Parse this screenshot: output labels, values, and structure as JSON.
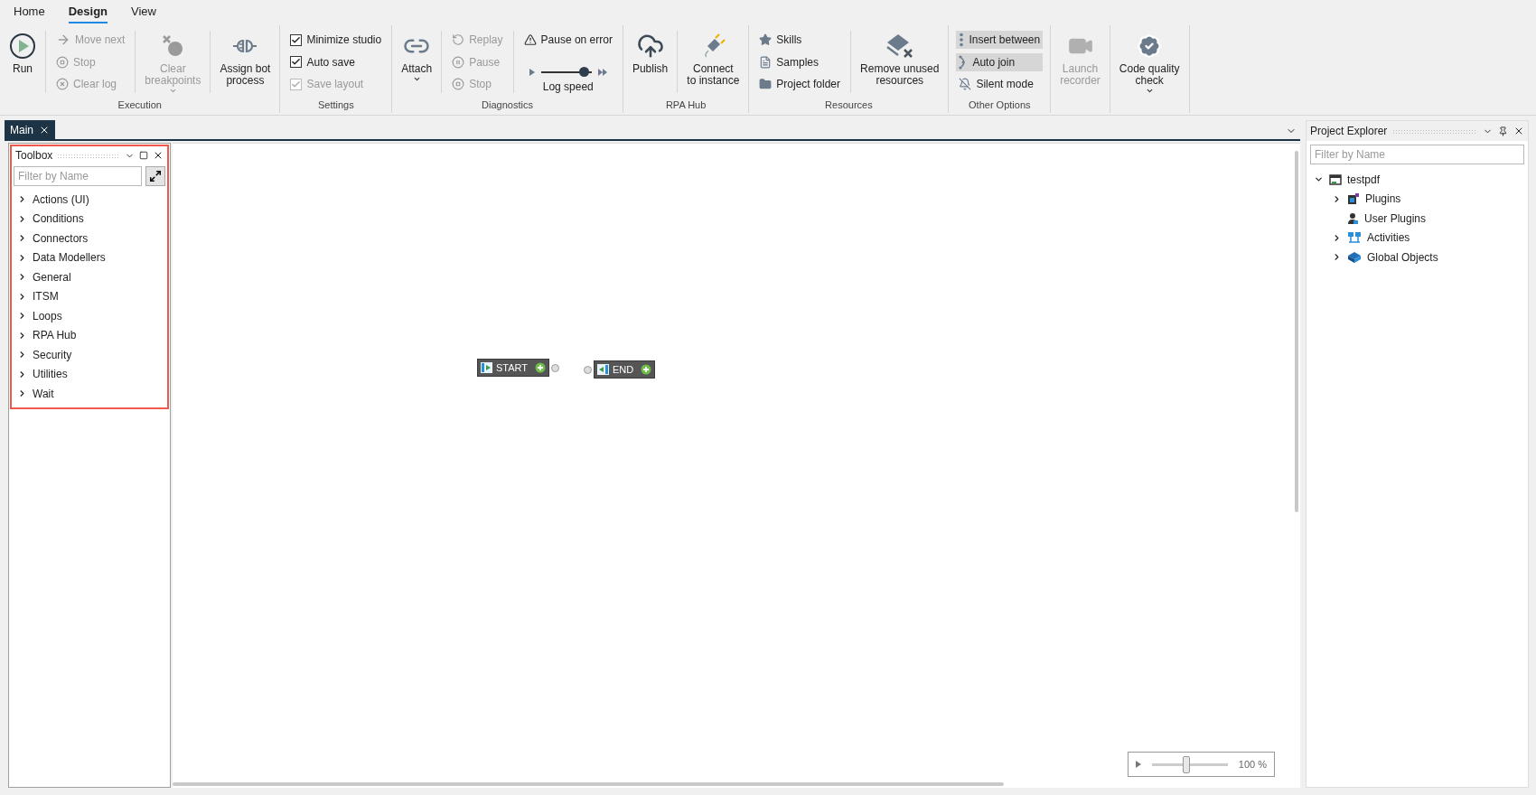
{
  "ribbon": {
    "tabs": [
      {
        "label": "Home",
        "selected": false
      },
      {
        "label": "Design",
        "selected": true
      },
      {
        "label": "View",
        "selected": false
      }
    ],
    "groups": [
      {
        "label": "Execution",
        "columns": [
          {
            "kind": "large",
            "label": "Run",
            "disabled": false
          },
          {
            "kind": "stack",
            "items": [
              {
                "kind": "button",
                "label": "Move next",
                "disabled": true
              },
              {
                "kind": "button",
                "label": "Stop",
                "disabled": true
              },
              {
                "kind": "button",
                "label": "Clear log",
                "disabled": true
              }
            ]
          },
          {
            "kind": "large",
            "label": "Clear\nbreakpoints",
            "disabled": true,
            "dropdown": true
          },
          {
            "kind": "large",
            "label": "Assign bot\nprocess",
            "disabled": false
          }
        ]
      },
      {
        "label": "Settings",
        "columns": [
          {
            "kind": "stack",
            "items": [
              {
                "kind": "check",
                "label": "Minimize studio",
                "checked": true,
                "disabled": false
              },
              {
                "kind": "check",
                "label": "Auto save",
                "checked": true,
                "disabled": false
              },
              {
                "kind": "check",
                "label": "Save layout",
                "checked": true,
                "disabled": true
              }
            ]
          }
        ]
      },
      {
        "label": "Diagnostics",
        "columns": [
          {
            "kind": "large",
            "label": "Attach",
            "disabled": false,
            "dropdown": true
          },
          {
            "kind": "stack",
            "items": [
              {
                "kind": "button",
                "label": "Replay",
                "disabled": true
              },
              {
                "kind": "button",
                "label": "Pause",
                "disabled": true
              },
              {
                "kind": "button",
                "label": "Stop",
                "disabled": true
              }
            ]
          },
          {
            "kind": "stack",
            "items": [
              {
                "kind": "button",
                "label": "Pause on error",
                "disabled": false
              },
              {
                "kind": "slider",
                "label": "Log speed",
                "level": 0.85
              }
            ]
          }
        ]
      },
      {
        "label": "RPA Hub",
        "columns": [
          {
            "kind": "large",
            "label": "Publish",
            "disabled": false
          },
          {
            "kind": "large",
            "label": "Connect\nto instance",
            "disabled": false
          }
        ]
      },
      {
        "label": "Resources",
        "columns": [
          {
            "kind": "stack",
            "items": [
              {
                "kind": "button",
                "label": "Skills",
                "disabled": false
              },
              {
                "kind": "button",
                "label": "Samples",
                "disabled": false
              },
              {
                "kind": "button",
                "label": "Project folder",
                "disabled": false
              }
            ]
          },
          {
            "kind": "large",
            "label": "Remove unused\nresources",
            "disabled": false
          }
        ]
      },
      {
        "label": "Other Options",
        "columns": [
          {
            "kind": "stack",
            "items": [
              {
                "kind": "toggle",
                "label": "Insert between",
                "on": true
              },
              {
                "kind": "toggle",
                "label": "Auto join",
                "on": true
              },
              {
                "kind": "toggle",
                "label": "Silent mode",
                "on": false
              }
            ]
          }
        ]
      },
      {
        "columns": [
          {
            "kind": "large",
            "label": "Launch\nrecorder",
            "disabled": true
          }
        ]
      },
      {
        "columns": [
          {
            "kind": "large",
            "label": "Code quality\ncheck",
            "disabled": false,
            "dropdown": true
          }
        ]
      }
    ]
  },
  "document_tabs": [
    {
      "label": "Main",
      "selected": true
    }
  ],
  "toolbox": {
    "title": "Toolbox",
    "filter": {
      "placeholder": "Filter by Name"
    },
    "items": [
      {
        "label": "Actions (UI)",
        "expanded": false
      },
      {
        "label": "Conditions",
        "expanded": false
      },
      {
        "label": "Connectors",
        "expanded": false
      },
      {
        "label": "Data Modellers",
        "expanded": false
      },
      {
        "label": "General",
        "expanded": false
      },
      {
        "label": "ITSM",
        "expanded": false
      },
      {
        "label": "Loops",
        "expanded": false
      },
      {
        "label": "RPA Hub",
        "expanded": false
      },
      {
        "label": "Security",
        "expanded": false
      },
      {
        "label": "Utilities",
        "expanded": false
      },
      {
        "label": "Wait",
        "expanded": false
      }
    ]
  },
  "canvas": {
    "nodes": [
      {
        "kind": "start",
        "label": "START"
      },
      {
        "kind": "end",
        "label": "END"
      }
    ],
    "zoom": {
      "level": 0.45,
      "reading": "100 %"
    }
  },
  "project_explorer": {
    "title": "Project Explorer",
    "filter": {
      "placeholder": "Filter by Name"
    },
    "tree": [
      {
        "label": "testpdf",
        "expanded": true,
        "children": [
          {
            "label": "Plugins",
            "expanded": false
          },
          {
            "label": "User Plugins"
          },
          {
            "label": "Activities",
            "expanded": false
          },
          {
            "label": "Global Objects",
            "expanded": false
          }
        ]
      }
    ]
  }
}
